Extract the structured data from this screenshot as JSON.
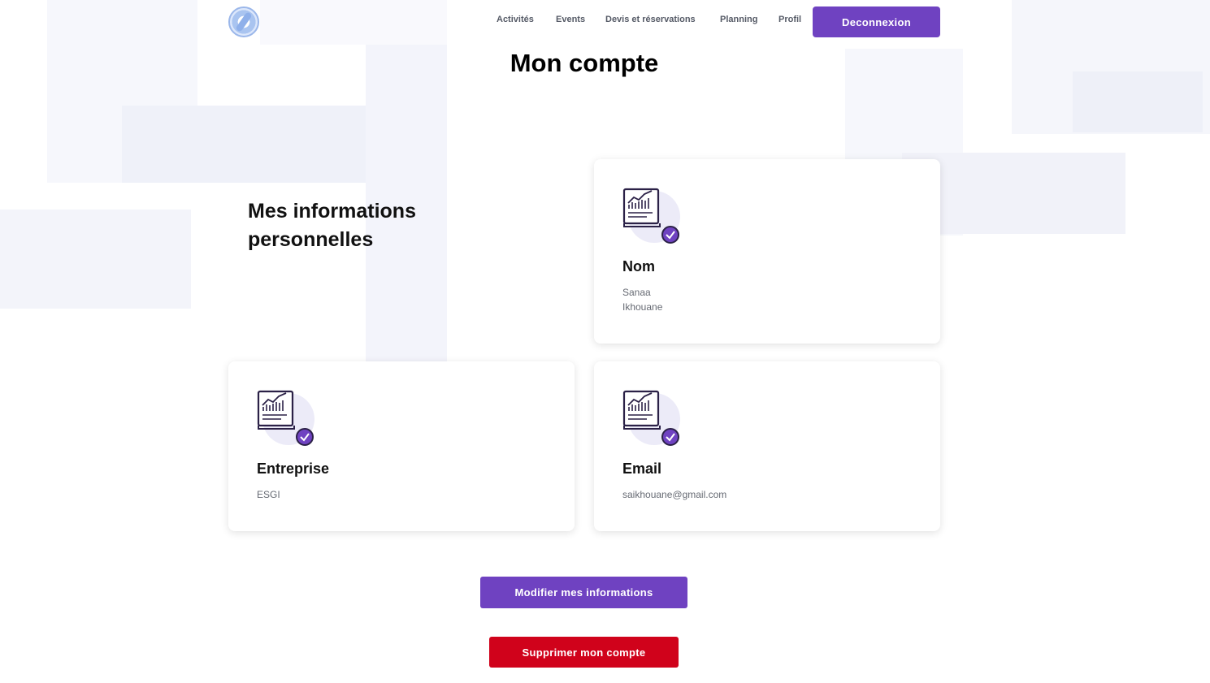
{
  "nav": {
    "links": [
      "Activités",
      "Events",
      "Devis et réservations",
      "Planning",
      "Profil"
    ],
    "logout_label": "Deconnexion"
  },
  "page": {
    "title": "Mon compte",
    "section_heading_line1": "Mes informations",
    "section_heading_line2": "personnelles"
  },
  "cards": {
    "nom": {
      "title": "Nom",
      "line1": "Sanaa",
      "line2": "Ikhouane"
    },
    "entreprise": {
      "title": "Entreprise",
      "value": "ESGI"
    },
    "email": {
      "title": "Email",
      "value": "saikhouane@gmail.com"
    }
  },
  "actions": {
    "edit_label": "Modifier mes informations",
    "delete_label": "Supprimer mon compte"
  },
  "colors": {
    "accent": "#6f42c1",
    "danger": "#d0021b"
  },
  "icons": {
    "logo": "logo-icon",
    "card": "report-check-icon"
  }
}
